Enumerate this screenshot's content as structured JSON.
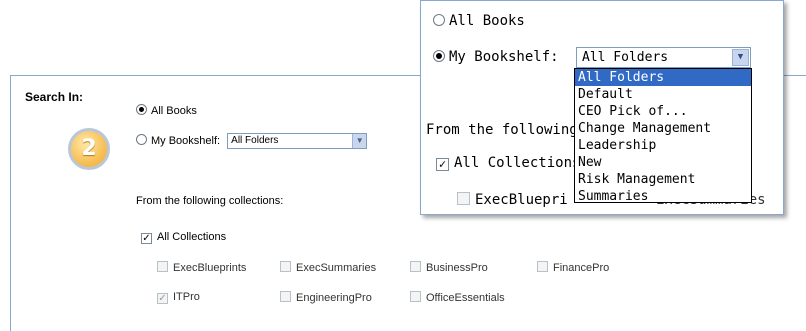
{
  "step_badge": "2",
  "search": {
    "label": "Search In:",
    "all_books": "All Books",
    "my_bookshelf": "My Bookshelf:",
    "folder_selected": "All Folders"
  },
  "collections": {
    "heading": "From the following collections:",
    "all_label": "All Collections",
    "items": [
      "ExecBlueprints",
      "ExecSummaries",
      "BusinessPro",
      "FinancePro",
      "ITPro",
      "EngineeringPro",
      "OfficeEssentials"
    ]
  },
  "zoom": {
    "all_books": "All Books",
    "my_bookshelf": "My Bookshelf:",
    "folder_selected": "All Folders",
    "from_partial": "From the following",
    "all_collections": "All Collections",
    "exec_partial": "ExecBluepri",
    "exec_partial2": "ExecSummaries",
    "options": [
      "All Folders",
      "Default",
      "CEO Pick of...",
      "Change Management",
      "Leadership",
      "New",
      "Risk Management",
      "Summaries"
    ]
  },
  "icons": {
    "dropdown": "chevron-down-icon"
  }
}
